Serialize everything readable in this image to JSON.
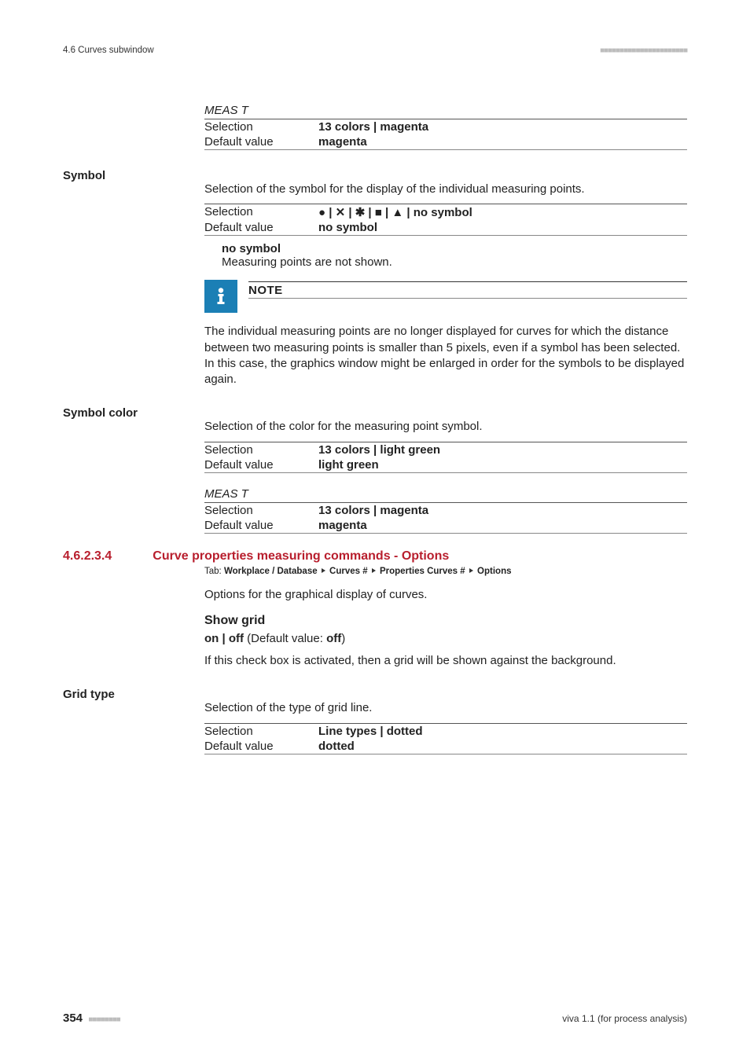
{
  "header": {
    "section": "4.6 Curves subwindow"
  },
  "meast_line": {
    "italic": "MEAS T"
  },
  "line_color_meast": {
    "sel_label": "Selection",
    "sel_val": "13 colors | magenta",
    "def_label": "Default value",
    "def_val": "magenta"
  },
  "symbol": {
    "label": "Symbol",
    "desc": "Selection of the symbol for the display of the individual measuring points.",
    "sel_label": "Selection",
    "sel_val": "● | ✕ | ✱ | ■ | ▲ | no symbol",
    "def_label": "Default value",
    "def_val": "no symbol",
    "sub_t": "no symbol",
    "sub_b": "Measuring points are not shown.",
    "note_t": "NOTE",
    "note_b": "The individual measuring points are no longer displayed for curves for which the distance between two measuring points is smaller than 5 pixels, even if a symbol has been selected. In this case, the graphics window might be enlarged in order for the symbols to be displayed again."
  },
  "symbol_color": {
    "label": "Symbol color",
    "desc": "Selection of the color for the measuring point symbol.",
    "sel_label": "Selection",
    "sel_val": "13 colors | light green",
    "def_label": "Default value",
    "def_val": "light green",
    "meast": "MEAS T",
    "sel2_label": "Selection",
    "sel2_val": "13 colors | magenta",
    "def2_label": "Default value",
    "def2_val": "magenta"
  },
  "section": {
    "num": "4.6.2.3.4",
    "title": "Curve properties measuring commands - Options",
    "tab_pre": "Tab: ",
    "tab_a": "Workplace / Database ",
    "tab_b": " Curves # ",
    "tab_c": " Properties Curves # ",
    "tab_d": " Options",
    "desc": "Options for the graphical display of curves.",
    "show_grid": "Show grid",
    "onoff_a": "on | off",
    "onoff_b": " (Default value: ",
    "onoff_c": "off",
    "onoff_d": ")",
    "grid_desc": "If this check box is activated, then a grid will be shown against the background."
  },
  "grid_type": {
    "label": "Grid type",
    "desc": "Selection of the type of grid line.",
    "sel_label": "Selection",
    "sel_val": "Line types | dotted",
    "def_label": "Default value",
    "def_val": "dotted"
  },
  "footer": {
    "page": "354",
    "right": "viva 1.1 (for process analysis)"
  }
}
